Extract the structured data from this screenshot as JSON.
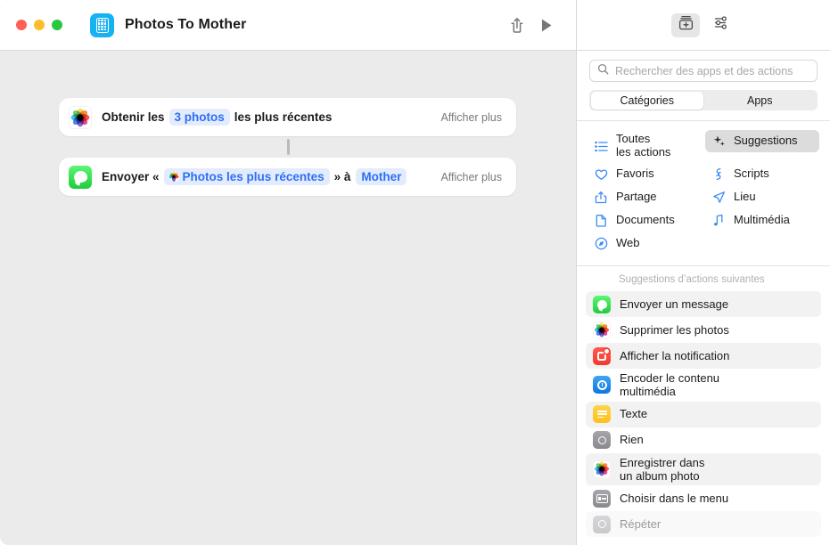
{
  "window": {
    "traffic_lights": [
      "close",
      "minimize",
      "zoom"
    ],
    "colors": {
      "close": "#ff5f57",
      "minimize": "#febc2e",
      "zoom": "#28c840",
      "accent": "#2d6ff5",
      "token_bg": "#e3ecfd"
    }
  },
  "titlebar": {
    "app_icon": "shortcut-grid-icon",
    "title": "Photos To Mother",
    "buttons": [
      {
        "name": "share-button",
        "icon": "share-icon"
      },
      {
        "name": "run-button",
        "icon": "play-icon"
      }
    ]
  },
  "workflow": {
    "actions": [
      {
        "icon": "photos-app-icon",
        "prefix": "Obtenir les",
        "token": "3 photos",
        "suffix": "les plus récentes",
        "show_more": "Afficher plus"
      },
      {
        "icon": "messages-app-icon",
        "prefix": "Envoyer «",
        "token": "Photos les plus récentes",
        "token_icon": "photos-app-icon",
        "middle": "» à",
        "token2": "Mother",
        "show_more": "Afficher plus"
      }
    ]
  },
  "panel": {
    "toolbar": [
      {
        "name": "action-library-button",
        "icon": "add-action-icon",
        "active": true
      },
      {
        "name": "shortcut-details-button",
        "icon": "sliders-icon",
        "active": false
      }
    ],
    "search": {
      "icon": "search-icon",
      "placeholder": "Rechercher des apps et des actions",
      "value": ""
    },
    "segmented": {
      "options": [
        "Catégories",
        "Apps"
      ],
      "selected": "Catégories"
    },
    "categories": [
      {
        "label": "Toutes\nles actions",
        "label_line1": "Toutes",
        "label_line2": "les actions",
        "icon": "list-bullet-icon",
        "selected": false,
        "two_line": true
      },
      {
        "label": "Suggestions",
        "icon": "sparkles-icon",
        "selected": true,
        "two_line": false
      },
      {
        "label": "Favoris",
        "icon": "heart-icon",
        "selected": false,
        "two_line": false
      },
      {
        "label": "Scripts",
        "icon": "scripts-icon",
        "selected": false,
        "two_line": false
      },
      {
        "label": "Partage",
        "icon": "share-icon",
        "selected": false,
        "two_line": false
      },
      {
        "label": "Lieu",
        "icon": "location-arrow-icon",
        "selected": false,
        "two_line": false
      },
      {
        "label": "Documents",
        "icon": "document-icon",
        "selected": false,
        "two_line": false
      },
      {
        "label": "Multimédia",
        "icon": "music-note-icon",
        "selected": false,
        "two_line": false
      },
      {
        "label": "Web",
        "icon": "safari-compass-icon",
        "selected": false,
        "two_line": false
      }
    ],
    "suggestions_header": "Suggestions d’actions suivantes",
    "suggestions": [
      {
        "label": "Envoyer un message",
        "icon": "messages-app-icon",
        "striped": true
      },
      {
        "label": "Supprimer les photos",
        "icon": "photos-app-icon",
        "striped": false
      },
      {
        "label": "Afficher la notification",
        "icon": "notification-app-icon",
        "striped": true
      },
      {
        "label": "Encoder le contenu multimédia",
        "label_line1": "Encoder le contenu",
        "label_line2": "multimédia",
        "icon": "media-encode-icon",
        "striped": false,
        "two_line": true
      },
      {
        "label": "Texte",
        "icon": "text-icon",
        "striped": true
      },
      {
        "label": "Rien",
        "icon": "nothing-icon",
        "striped": false
      },
      {
        "label": "Enregistrer dans un album photo",
        "label_line1": "Enregistrer dans",
        "label_line2": "un album photo",
        "icon": "photos-app-icon",
        "striped": true,
        "two_line": true
      },
      {
        "label": "Choisir dans le menu",
        "icon": "menu-choose-icon",
        "striped": false
      },
      {
        "label": "Répéter",
        "icon": "repeat-icon",
        "striped": true,
        "clipped": true
      }
    ]
  }
}
